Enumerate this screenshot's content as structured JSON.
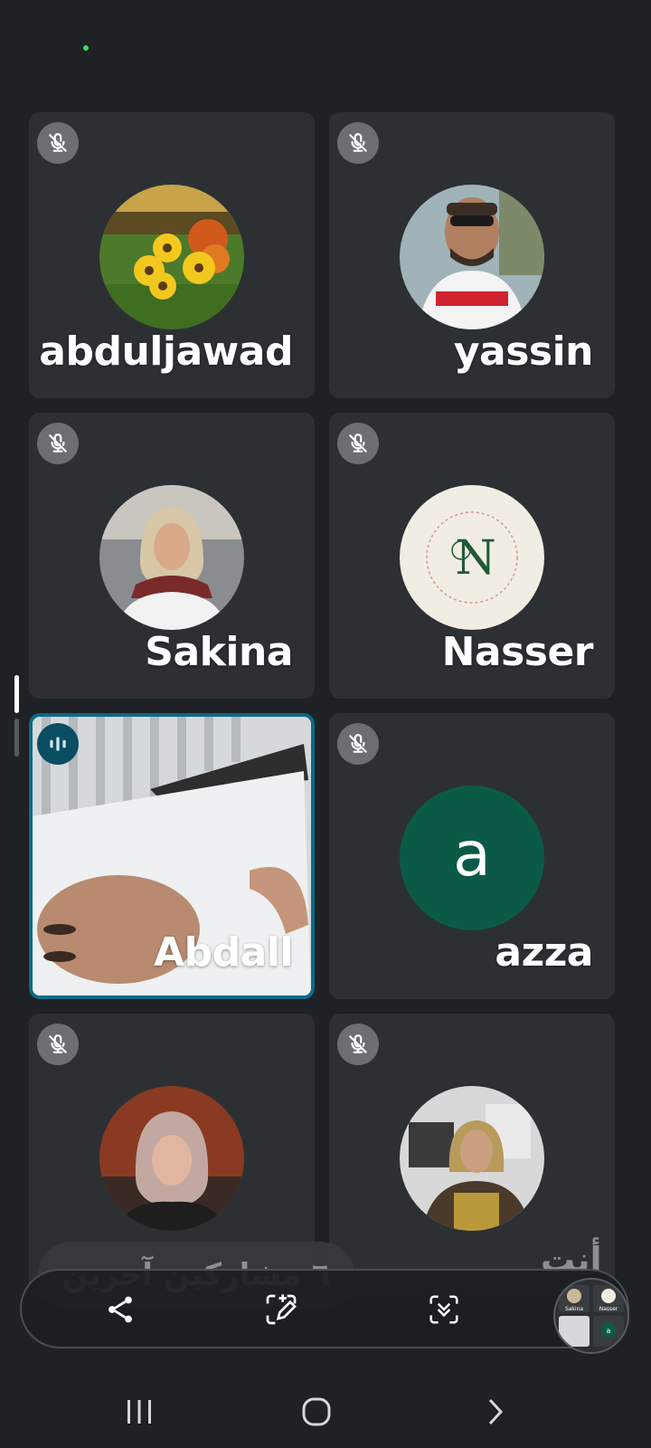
{
  "meeting": {
    "participants": [
      {
        "name": "abduljawad",
        "muted": true,
        "avatar": "flowers-photo"
      },
      {
        "name": "yassin",
        "muted": true,
        "avatar": "man-sunglasses-photo"
      },
      {
        "name": "Sakina",
        "muted": true,
        "avatar": "woman-hijab-photo"
      },
      {
        "name": "Nasser",
        "muted": true,
        "avatar": "N",
        "avatar_color": "#f2ede4"
      },
      {
        "name": "Abdall",
        "muted": false,
        "speaking": true,
        "avatar": "live-video"
      },
      {
        "name": "azza",
        "muted": true,
        "avatar": "a",
        "avatar_color": "#0b5a47"
      },
      {
        "name": "",
        "muted": true,
        "avatar": "woman-hijab-photo-2"
      },
      {
        "name": "",
        "muted": true,
        "avatar": "woman-hijab-photo-3"
      }
    ],
    "others_label": "٦ مشاركين آخرين",
    "self_label": "أنت",
    "active_speaker_color": "#0b6a86"
  },
  "toolbar": {
    "buttons": [
      "share-icon",
      "annotate-icon",
      "scroll-capture-icon"
    ]
  },
  "thumbnail": {
    "labels": [
      "Sakina",
      "Nasser",
      "a"
    ]
  },
  "navbar": {
    "buttons": [
      "recent-apps-icon",
      "home-icon",
      "back-icon"
    ]
  }
}
